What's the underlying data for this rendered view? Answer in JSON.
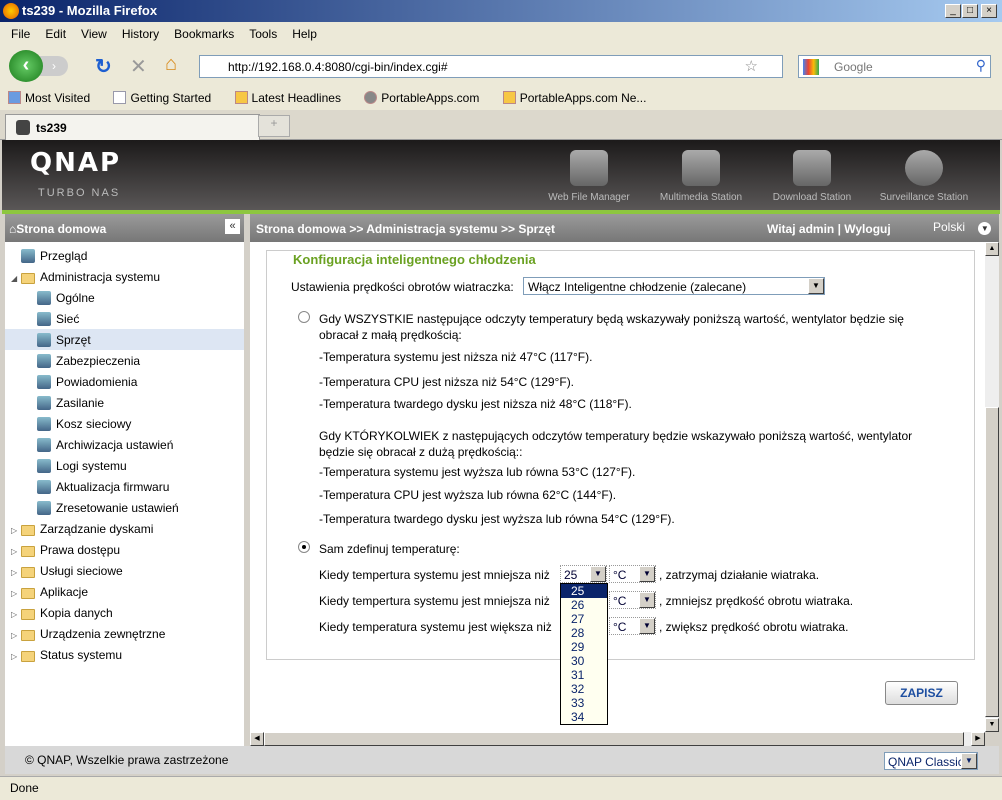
{
  "window": {
    "title": "ts239 - Mozilla Firefox"
  },
  "menu": [
    "File",
    "Edit",
    "View",
    "History",
    "Bookmarks",
    "Tools",
    "Help"
  ],
  "url": "http://192.168.0.4:8080/cgi-bin/index.cgi#",
  "search_placeholder": "Google",
  "bookmarks": [
    "Most Visited",
    "Getting Started",
    "Latest Headlines",
    "PortableApps.com",
    "PortableApps.com Ne..."
  ],
  "tab": "ts239",
  "header": {
    "logo": "QNAP",
    "subtitle": "TURBO NAS",
    "apps": [
      "Web File Manager",
      "Multimedia Station",
      "Download Station",
      "Surveillance Station"
    ]
  },
  "sidebar": {
    "title": "Strona domowa",
    "items": [
      {
        "label": "Przegląd",
        "level": 0
      },
      {
        "label": "Administracja systemu",
        "level": 0,
        "folder": true,
        "open": true
      },
      {
        "label": "Ogólne",
        "level": 1
      },
      {
        "label": "Sieć",
        "level": 1
      },
      {
        "label": "Sprzęt",
        "level": 1,
        "selected": true
      },
      {
        "label": "Zabezpieczenia",
        "level": 1
      },
      {
        "label": "Powiadomienia",
        "level": 1
      },
      {
        "label": "Zasilanie",
        "level": 1
      },
      {
        "label": "Kosz sieciowy",
        "level": 1
      },
      {
        "label": "Archiwizacja ustawień",
        "level": 1
      },
      {
        "label": "Logi systemu",
        "level": 1
      },
      {
        "label": "Aktualizacja firmwaru",
        "level": 1
      },
      {
        "label": "Zresetowanie ustawień",
        "level": 1
      },
      {
        "label": "Zarządzanie dyskami",
        "level": 0,
        "folder": true
      },
      {
        "label": "Prawa dostępu",
        "level": 0,
        "folder": true
      },
      {
        "label": "Usługi sieciowe",
        "level": 0,
        "folder": true
      },
      {
        "label": "Aplikacje",
        "level": 0,
        "folder": true
      },
      {
        "label": "Kopia danych",
        "level": 0,
        "folder": true
      },
      {
        "label": "Urządzenia zewnętrzne",
        "level": 0,
        "folder": true
      },
      {
        "label": "Status systemu",
        "level": 0,
        "folder": true
      }
    ]
  },
  "breadcrumb": "Strona domowa >> Administracja systemu >> Sprzęt",
  "welcome": "Witaj admin | Wyloguj",
  "language": "Polski",
  "content": {
    "title": "Konfiguracja inteligentnego chłodzenia",
    "fan_label": "Ustawienia prędkości obrotów wiatraczka:",
    "fan_value": "Włącz Inteligentne chłodzenie (zalecane)",
    "auto_lines": [
      "Gdy WSZYSTKIE następujące odczyty temperatury będą wskazywały poniższą wartość, wentylator będzie się",
      "obracał z małą prędkością:",
      "-Temperatura systemu jest niższa niż 47°C (117°F).",
      "-Temperatura CPU jest niższa niż 54°C (129°F).",
      "-Temperatura twardego dysku jest niższa niż 48°C (118°F).",
      "Gdy KTÓRYKOLWIEK z następujących odczytów temperatury będzie wskazywało poniższą wartość, wentylator",
      "będzie się obracał z dużą prędkością::",
      "-Temperatura systemu jest wyższa lub równa 53°C (127°F).",
      "-Temperatura CPU jest wyższa lub równa 62°C (144°F).",
      "-Temperatura twardego dysku jest wyższa lub równa 54°C (129°F)."
    ],
    "custom_label": "Sam zdefinuj temperaturę:",
    "rules": [
      {
        "pre": "Kiedy tempertura systemu jest mniejsza niż",
        "value": "25",
        "unit": "°C",
        "post": ", zatrzymaj działanie wiatraka."
      },
      {
        "pre": "Kiedy tempertura systemu jest mniejsza niż",
        "unit": "°C",
        "post": ", zmniejsz prędkość obrotu wiatraka."
      },
      {
        "pre": "Kiedy temperatura systemu jest większa niż",
        "unit": "°C",
        "post": ", zwiększ prędkość obrotu wiatraka."
      }
    ],
    "dropdown_options": [
      "25",
      "26",
      "27",
      "28",
      "29",
      "30",
      "31",
      "32",
      "33",
      "34"
    ],
    "save": "ZAPISZ"
  },
  "footer": {
    "copyright": "© QNAP, Wszelkie prawa zastrzeżone",
    "theme": "QNAP Classic"
  },
  "status": "Done"
}
